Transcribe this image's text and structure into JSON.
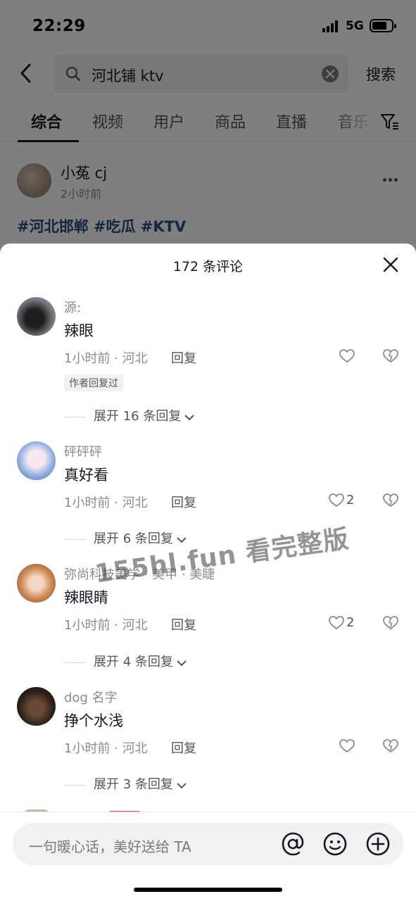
{
  "status_bar": {
    "time": "22:29",
    "network": "5G"
  },
  "search": {
    "query": "河北铺 ktv",
    "submit_label": "搜索"
  },
  "tabs": [
    "综合",
    "视频",
    "用户",
    "商品",
    "直播",
    "音乐"
  ],
  "post": {
    "author": "小菟 cj",
    "time": "2小时前",
    "hashtags": "#河北邯郸 #吃瓜 #KTV"
  },
  "sheet": {
    "title": "172 条评论"
  },
  "comments": [
    {
      "name": "源:",
      "text": "辣眼",
      "meta": "1小时前 · 河北",
      "reply": "回复",
      "likes": "",
      "badge": "作者回复过",
      "expand": "展开 16 条回复"
    },
    {
      "name": "砰砰砰",
      "text": "真好看",
      "meta": "1小时前 · 河北",
      "reply": "回复",
      "likes": "2",
      "badge": "",
      "expand": "展开 6 条回复"
    },
    {
      "name": "弥尚科技美学 · 美甲 · 美睫",
      "text": "辣眼睛",
      "meta": "1小时前 · 河北",
      "reply": "回复",
      "likes": "2",
      "badge": "",
      "expand": "展开 4 条回复"
    },
    {
      "name": "dog 名字",
      "text": "挣个水浅",
      "meta": "1小时前 · 河北",
      "reply": "回复",
      "likes": "",
      "badge": "",
      "expand": "展开 3 条回复"
    }
  ],
  "watermark": "155hl.fun 看完整版",
  "input": {
    "placeholder": "一句暖心话，美好送给 TA"
  },
  "colors": {
    "accent": "#fe2c55",
    "hashtag": "#2b4d80",
    "text": "#161823",
    "muted": "#8a8b91"
  }
}
